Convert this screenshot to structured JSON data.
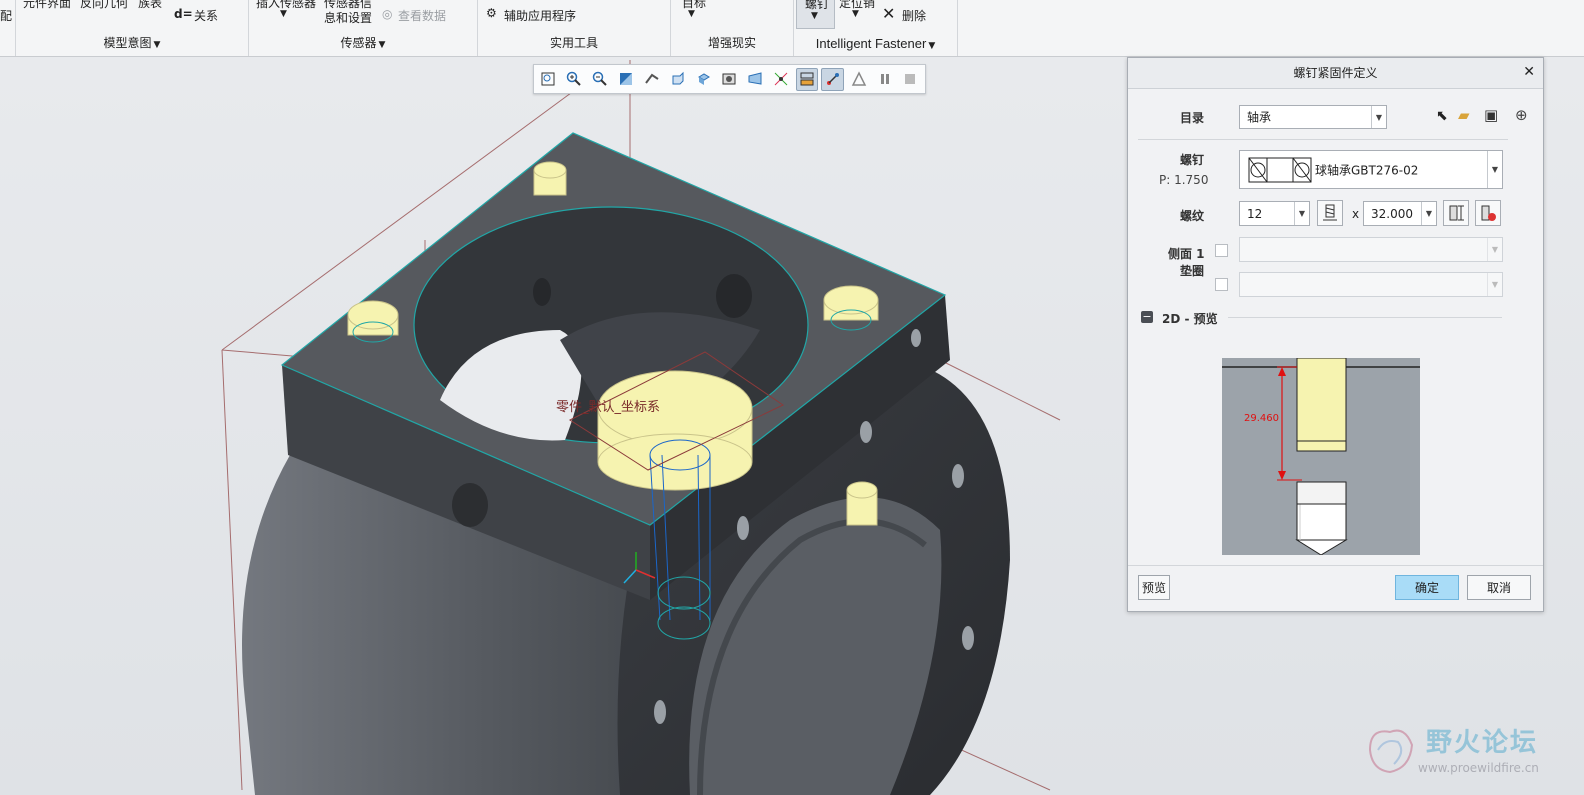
{
  "ribbon": {
    "partial_top": {
      "left_cut": "配",
      "text1": "元件界面",
      "text2": "反向几何",
      "text3": "族表",
      "relations_prefix": "d=",
      "relations": "关系",
      "insert_sensor": "插入传感器",
      "sensor_info_line1": "传感器信",
      "sensor_info_line2": "息和设置",
      "view_data": "查看数据",
      "aux_app": "辅助应用程序",
      "target": "目标",
      "bolt": "螺钉",
      "locator": "定位销",
      "delete": "删除"
    },
    "groups": [
      {
        "label": "模型意图"
      },
      {
        "label": "传感器"
      },
      {
        "label": "实用工具"
      },
      {
        "label": "增强现实"
      },
      {
        "label": "Intelligent Fastener"
      }
    ]
  },
  "viewport": {
    "csys_label": "零件_默认_坐标系",
    "toolbar": [
      {
        "icon": "refit-icon",
        "active": false
      },
      {
        "icon": "zoom-in-icon",
        "active": false
      },
      {
        "icon": "zoom-out-icon",
        "active": false
      },
      {
        "icon": "repaint-icon",
        "active": false
      },
      {
        "icon": "view-manager-icon",
        "active": false
      },
      {
        "icon": "saved-orientations-icon",
        "active": false
      },
      {
        "icon": "named-views-icon",
        "active": false
      },
      {
        "icon": "display-style-icon",
        "active": false
      },
      {
        "icon": "perspective-icon",
        "active": false
      },
      {
        "icon": "datum-display-icon",
        "active": false
      },
      {
        "icon": "annotation-display-icon",
        "active": true
      },
      {
        "icon": "spin-center-icon",
        "active": true
      },
      {
        "icon": "simulation-icon",
        "active": false
      },
      {
        "icon": "pause-icon",
        "active": false
      },
      {
        "icon": "stop-icon",
        "active": false
      }
    ]
  },
  "dialog": {
    "title": "螺钉紧固件定义",
    "catalog_label": "目录",
    "catalog_value": "轴承",
    "screw_label": "螺钉",
    "pitch_label": "P: 1.750",
    "screw_value": "球轴承GBT276-02",
    "thread_label": "螺纹",
    "thread_size": "12",
    "x_sep": "x",
    "thread_length": "32.000",
    "side1_label": "侧面 1",
    "washer_label": "垫圈",
    "preview_section": "2D - 预览",
    "dimension": "29.460",
    "preview_button": "预览",
    "ok_button": "确定",
    "cancel_button": "取消"
  },
  "watermark": {
    "title": "野火论坛",
    "url": "www.proewildfire.cn"
  },
  "colors": {
    "part_dark": "#4a4e54",
    "fastener_yellow": "#f6f3b0",
    "edge_cyan": "#21a7a7",
    "bolt_blue": "#1b66c9",
    "ok_blue": "#a9dcf7",
    "dim_red": "#e01010"
  }
}
